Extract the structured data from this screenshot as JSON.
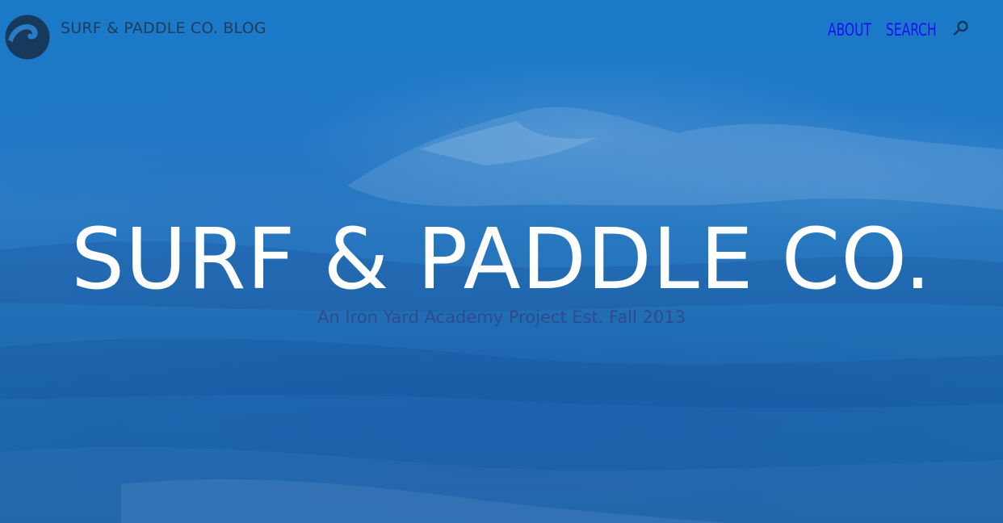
{
  "header": {
    "brand": "SURF & PADDLE CO. BLOG",
    "logo_icon": "wave-logo-icon"
  },
  "nav": {
    "items": [
      {
        "label": "ABOUT"
      },
      {
        "label": "SEARCH"
      }
    ],
    "search_icon": "search-icon"
  },
  "hero": {
    "title": "SURF & PADDLE CO.",
    "subtitle": "An Iron Yard Academy Project Est. Fall 2013"
  },
  "colors": {
    "background_blue": "#1f78c6",
    "brand_text": "#1e3d5e",
    "nav_link": "#1a0ff2",
    "title": "#ffffff",
    "subtitle": "#2f4b8c",
    "logo": "#173a5c"
  }
}
